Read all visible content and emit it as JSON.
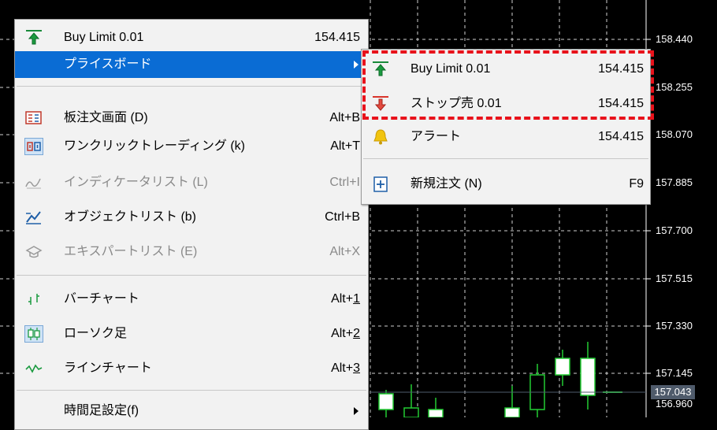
{
  "chart": {
    "price_labels": [
      "158.440",
      "158.255",
      "158.070",
      "157.885",
      "157.700",
      "157.515",
      "157.330",
      "157.145",
      "156.960"
    ],
    "current_price": "157.043",
    "colors": {
      "background": "#000000",
      "grid": "#d0d0d0",
      "candle_border": "#22cc33",
      "candle_bull_fill": "#ffffff",
      "candle_bear_fill": "#000000",
      "price_line": "#4f5b6b"
    }
  },
  "main_menu": {
    "items": [
      {
        "label": "Buy Limit 0.01",
        "shortcut": "154.415",
        "icon": "buy-arrow-icon"
      },
      {
        "label": "プライスボード",
        "icon": "none",
        "submenu": true,
        "highlighted": true
      },
      {
        "label": "板注文画面 (D)",
        "shortcut": "Alt+B",
        "icon": "order-book-icon"
      },
      {
        "label": "ワンクリックトレーディング (k)",
        "shortcut": "Alt+T",
        "icon": "one-click-trading-icon"
      },
      {
        "label": "インディケータリスト (L)",
        "shortcut": "Ctrl+I",
        "icon": "indicator-icon",
        "disabled": true
      },
      {
        "label": "オブジェクトリスト (b)",
        "shortcut": "Ctrl+B",
        "icon": "object-list-icon"
      },
      {
        "label": "エキスパートリスト (E)",
        "shortcut": "Alt+X",
        "icon": "expert-icon",
        "disabled": true
      },
      {
        "label": "バーチャート",
        "shortcut": "Alt+",
        "shortcut_key": "1",
        "icon": "bar-chart-icon"
      },
      {
        "label": "ローソク足",
        "shortcut": "Alt+",
        "shortcut_key": "2",
        "icon": "candlestick-icon"
      },
      {
        "label": "ラインチャート",
        "shortcut": "Alt+",
        "shortcut_key": "3",
        "icon": "line-chart-icon"
      },
      {
        "label": "時間足設定(f)",
        "icon": "none",
        "submenu": true
      }
    ]
  },
  "sub_menu": {
    "items": [
      {
        "label": "Buy Limit 0.01",
        "value": "154.415",
        "icon": "buy-arrow-icon"
      },
      {
        "label": "ストップ売 0.01",
        "value": "154.415",
        "icon": "sell-arrow-icon"
      },
      {
        "label": "アラート",
        "value": "154.415",
        "icon": "bell-icon"
      },
      {
        "label": "新規注文 (N)",
        "value": "F9",
        "icon": "new-order-icon"
      }
    ]
  }
}
